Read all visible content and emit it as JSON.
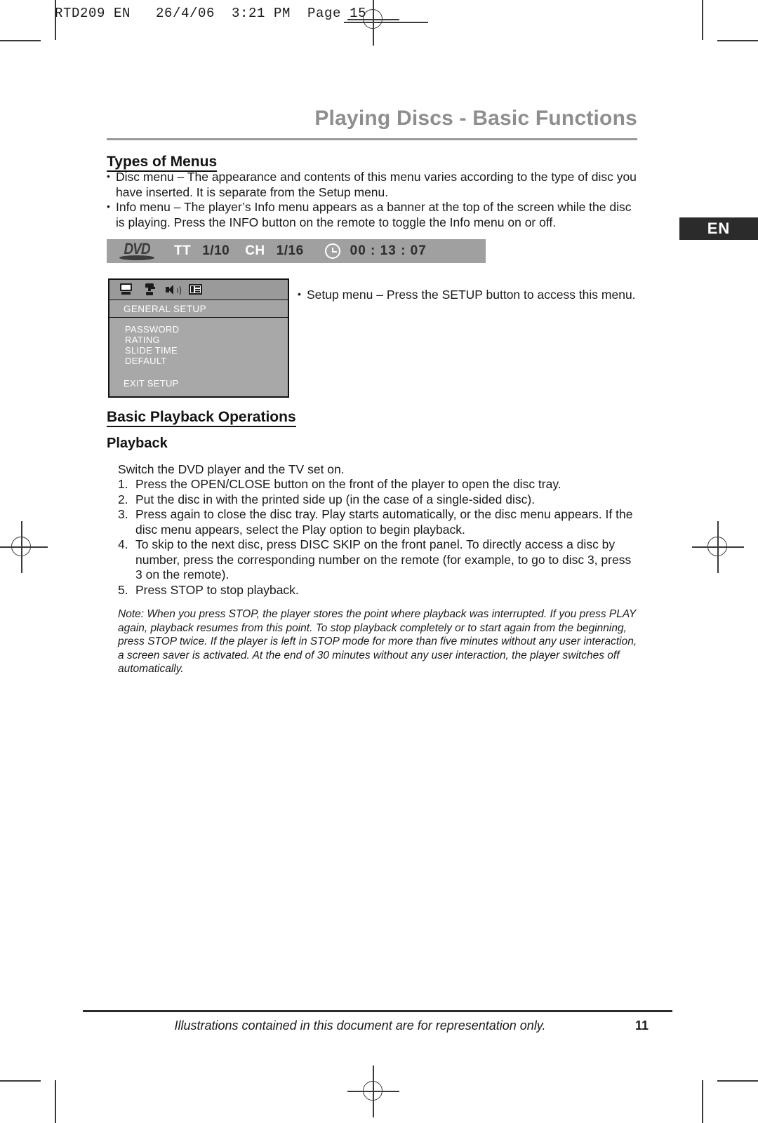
{
  "imprint": {
    "text": "RTD209 EN   26/4/06  3:21 PM  Page 15"
  },
  "chapter": {
    "title": "Playing Discs - Basic Functions"
  },
  "language_tab": {
    "label": "EN"
  },
  "sections": {
    "types_of_menus": {
      "heading": "Types of Menus",
      "bullets": [
        "Disc menu – The appearance and contents of this menu varies according to the type of disc you have inserted. It is separate from the Setup menu.",
        "Info menu – The player’s Info menu appears as a banner at the top of the screen while the disc is playing. Press the INFO button on the remote to toggle the Info menu on or off."
      ],
      "setup_bullet": "Setup menu – Press the SETUP button to access this menu."
    },
    "basic_playback": {
      "heading": "Basic Playback Operations",
      "subheading": "Playback",
      "intro": "Switch the DVD player and the TV set on.",
      "steps": [
        {
          "index": "1.",
          "text": "Press the OPEN/CLOSE button on the front of the player to open the disc tray."
        },
        {
          "index": "2.",
          "text": "Put the disc in with the printed side up (in the case of a single-sided disc)."
        },
        {
          "index": "3.",
          "text": "Press again to close the disc tray. Play starts automatically, or the disc menu appears. If the disc menu appears, select the Play option to begin playback."
        },
        {
          "index": "4.",
          "text": "To skip to the next disc, press DISC SKIP on the front panel. To directly access a disc by number, press the corresponding number on the remote (for example, to go to disc 3, press 3 on the remote)."
        },
        {
          "index": "5.",
          "text": "Press STOP to stop playback."
        }
      ],
      "note": "Note: When you press STOP, the player stores the point where playback was interrupted. If you press PLAY again, playback resumes from this point. To stop playback completely or to start again from the beginning, press STOP twice. If the player is left in STOP mode for more than five minutes without any user interaction, a screen saver is activated. At the end of 30 minutes without any user interaction, the player switches off automatically."
    }
  },
  "info_banner": {
    "logo": "DVD",
    "title_label": "TT",
    "title_value": "1/10",
    "chapter_label": "CH",
    "chapter_value": "1/16",
    "clock_icon": "clock-icon",
    "time": "00 : 13 : 07"
  },
  "osd_menu": {
    "icons": [
      "monitor-icon",
      "tool-icon",
      "speaker-icon",
      "preferences-icon"
    ],
    "title": "GENERAL SETUP",
    "items": [
      "PASSWORD",
      "RATING",
      "SLIDE TIME",
      "DEFAULT"
    ],
    "exit": "EXIT SETUP"
  },
  "footer": {
    "text": "Illustrations contained in this document are for representation only.",
    "page_number": "11"
  },
  "colors": {
    "chapter_title": "#8e8e8e",
    "lang_tab_bg": "#2b2b2b",
    "banner_bg": "#a0a0a0",
    "osd_bg": "#a8a8a8"
  }
}
